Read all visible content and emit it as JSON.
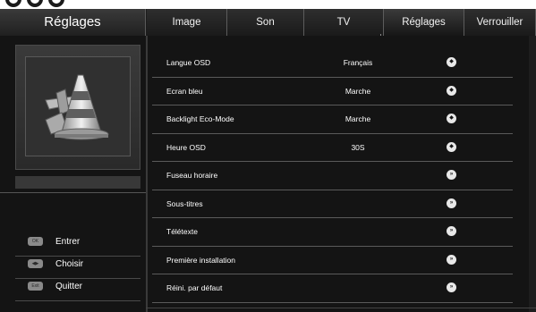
{
  "header": {
    "title": "Réglages",
    "tabs": [
      {
        "label": "Image"
      },
      {
        "label": "Son"
      },
      {
        "label": "TV"
      },
      {
        "label": "Réglages"
      },
      {
        "label": "Verrouiller"
      }
    ],
    "active_tab": "Réglages"
  },
  "left_panel": {
    "icon": "settings-tools-cone-icon",
    "hints": [
      {
        "key": "OK",
        "key_icon": "ok-key-icon",
        "label": "Entrer"
      },
      {
        "key": "◀▶",
        "key_icon": "arrow-keys-icon",
        "label": "Choisir"
      },
      {
        "key": "Exit",
        "key_icon": "exit-key-icon",
        "label": "Quitter"
      }
    ]
  },
  "settings": [
    {
      "name": "Langue OSD",
      "value": "Français",
      "control_icon": "adjust-icon",
      "control_glyph": "◆"
    },
    {
      "name": "Ecran bleu",
      "value": "Marche",
      "control_icon": "adjust-icon",
      "control_glyph": "◆"
    },
    {
      "name": "Backlight Eco-Mode",
      "value": "Marche",
      "control_icon": "adjust-icon",
      "control_glyph": "◆"
    },
    {
      "name": "Heure OSD",
      "value": "30S",
      "control_icon": "adjust-icon",
      "control_glyph": "◆"
    },
    {
      "name": "Fuseau horaire",
      "value": "",
      "control_icon": "enter-arrow-icon",
      "control_glyph": "»"
    },
    {
      "name": "Sous-titres",
      "value": "",
      "control_icon": "enter-arrow-icon",
      "control_glyph": "»"
    },
    {
      "name": "Télétexte",
      "value": "",
      "control_icon": "enter-arrow-icon",
      "control_glyph": "»"
    },
    {
      "name": "Première installation",
      "value": "",
      "control_icon": "enter-arrow-icon",
      "control_glyph": "»"
    },
    {
      "name": "Réini. par défaut",
      "value": "",
      "control_icon": "enter-arrow-icon",
      "control_glyph": "»"
    }
  ],
  "colors": {
    "background": "#141414",
    "header": "#1d1d1d",
    "text": "#ffffff",
    "divider": "#5a5a5a"
  }
}
